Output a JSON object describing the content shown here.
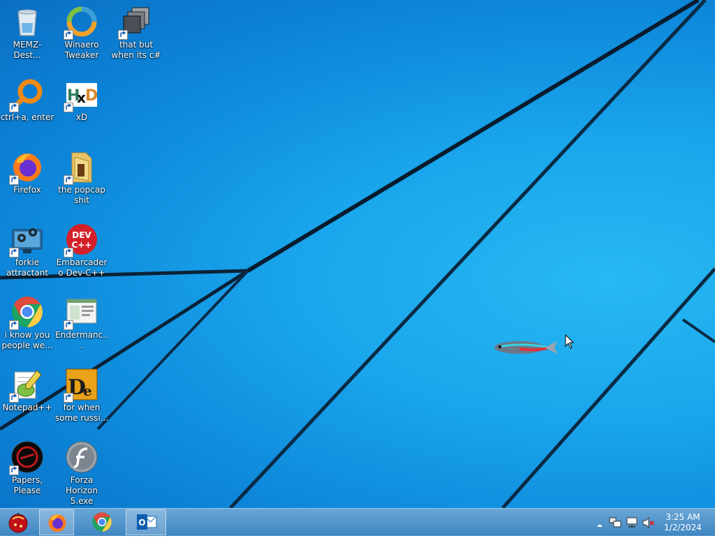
{
  "desktop": {
    "icons": [
      {
        "label": "MEMZ-Dest...",
        "icon": "recycle-bin-icon"
      },
      {
        "label": "Winaero Tweaker",
        "icon": "winaero-tweaker-icon"
      },
      {
        "label": "that but when its c#",
        "icon": "stacked-windows-icon"
      },
      {
        "label": "ctrl+a, enter",
        "icon": "orange-ring-icon"
      },
      {
        "label": "xD",
        "icon": "hxd-icon"
      },
      {
        "label": "Firefox",
        "icon": "firefox-icon"
      },
      {
        "label": "the popcap shit",
        "icon": "folder-icon"
      },
      {
        "label": "forkie attractant",
        "icon": "computer-settings-icon"
      },
      {
        "label": "Embarcadero Dev-C++",
        "icon": "devcpp-icon"
      },
      {
        "label": "i know you people we...",
        "icon": "chrome-icon"
      },
      {
        "label": "Endermanc...",
        "icon": "window-app-icon"
      },
      {
        "label": "Notepad++",
        "icon": "notepadpp-icon"
      },
      {
        "label": "for when some russi...",
        "icon": "de-icon"
      },
      {
        "label": "Papers, Please",
        "icon": "papers-please-icon"
      },
      {
        "label": "Forza Horizon 5.exe",
        "icon": "flash-icon"
      }
    ]
  },
  "taskbar": {
    "start": {
      "icon": "start-orb-icon"
    },
    "pinned": [
      {
        "name": "Firefox",
        "icon": "firefox-icon",
        "active": true
      },
      {
        "name": "Google Chrome",
        "icon": "chrome-icon",
        "active": false
      },
      {
        "name": "Outlook",
        "icon": "outlook-icon",
        "active": true
      }
    ],
    "tray": {
      "icons": [
        "show-hidden-icons-chevron",
        "network-icon",
        "wired-network-icon",
        "volume-muted-icon"
      ],
      "time": "3:25 AM",
      "date": "1/2/2024"
    }
  },
  "colors": {
    "desktop_blue": "#1aa6ec",
    "taskbar": "#4c8fc8"
  }
}
